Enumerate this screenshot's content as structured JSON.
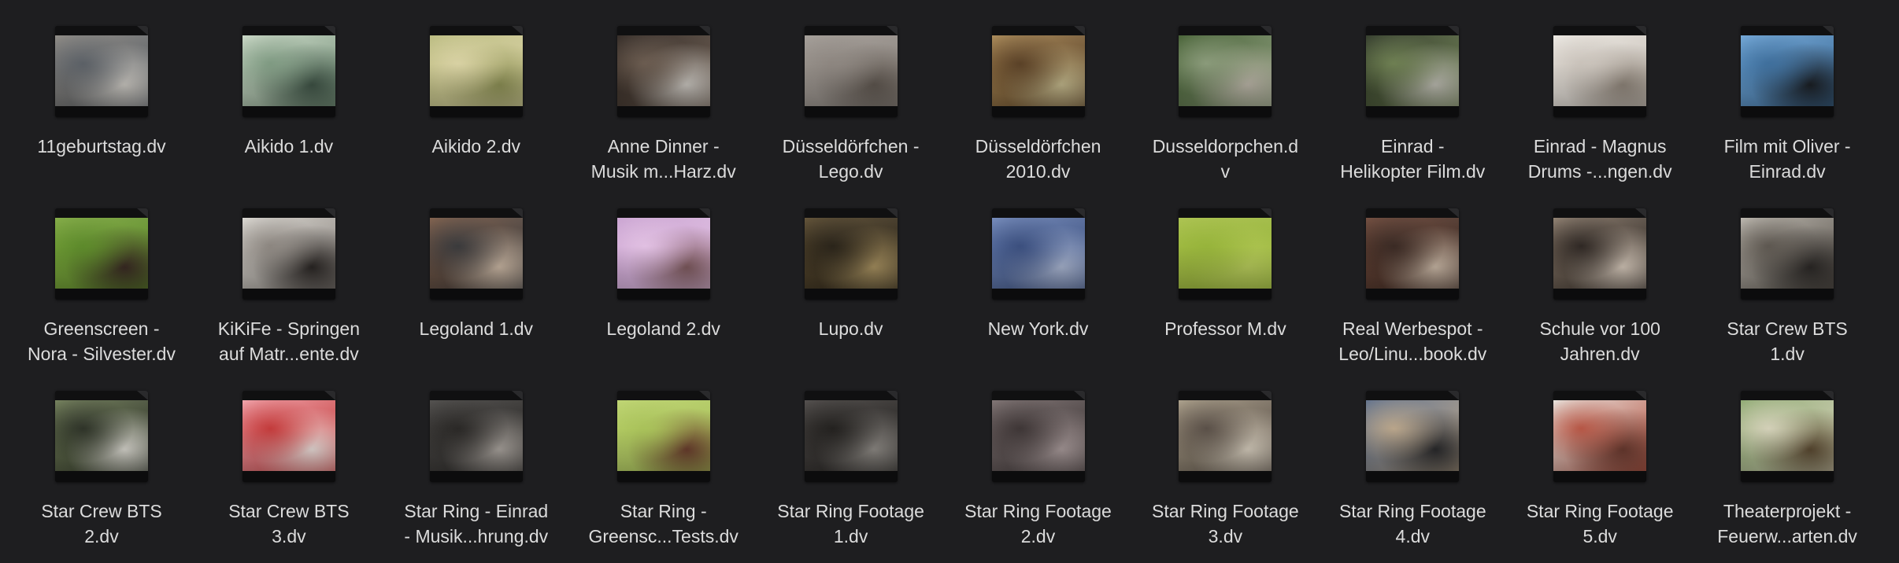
{
  "files": [
    {
      "lines": [
        "11geburtstag.dv"
      ],
      "colors": [
        "#8a8680",
        "#5b6066",
        "#c9c6c0"
      ]
    },
    {
      "lines": [
        "Aikido 1.dv"
      ],
      "colors": [
        "#c8d6c4",
        "#7f9a82",
        "#3e5245"
      ]
    },
    {
      "lines": [
        "Aikido 2.dv"
      ],
      "colors": [
        "#b7b87a",
        "#d8d1a3",
        "#8c8f55"
      ]
    },
    {
      "lines": [
        "Anne Dinner -",
        "Musik m...Harz.dv"
      ],
      "colors": [
        "#2a211c",
        "#6b5c50",
        "#c7c3bd"
      ]
    },
    {
      "lines": [
        "Düsseldörfchen -",
        "Lego.dv"
      ],
      "colors": [
        "#a09a94",
        "#8d8680",
        "#5e564f"
      ]
    },
    {
      "lines": [
        "Düsseldörfchen",
        "2010.dv"
      ],
      "colors": [
        "#a78652",
        "#5a4127",
        "#c0b58a"
      ]
    },
    {
      "lines": [
        "Dusseldorpchen.d",
        "v"
      ],
      "colors": [
        "#3e5a2c",
        "#8a9a7a",
        "#b9b3a6"
      ]
    },
    {
      "lines": [
        "Einrad -",
        "Helikopter Film.dv"
      ],
      "colors": [
        "#2a3322",
        "#6e7f52",
        "#b9b8ae"
      ]
    },
    {
      "lines": [
        "Einrad - Magnus",
        "Drums -...ngen.dv"
      ],
      "colors": [
        "#ece8e2",
        "#c9c2ba",
        "#8f857a"
      ]
    },
    {
      "lines": [
        "Film mit Oliver -",
        "Einrad.dv"
      ],
      "colors": [
        "#6da4d6",
        "#3f6f9c",
        "#1b1f24"
      ]
    },
    {
      "lines": [
        "Greenscreen -",
        "Nora - Silvester.dv"
      ],
      "colors": [
        "#7ea83e",
        "#5d8a2b",
        "#3a2a24"
      ]
    },
    {
      "lines": [
        "KiKiFe - Springen",
        "auf Matr...ente.dv"
      ],
      "colors": [
        "#d9d6d0",
        "#8c8680",
        "#2a2624"
      ]
    },
    {
      "lines": [
        "Legoland 1.dv"
      ],
      "colors": [
        "#7b5a45",
        "#3a3a3c",
        "#c8b5a2"
      ]
    },
    {
      "lines": [
        "Legoland 2.dv"
      ],
      "colors": [
        "#c79fcf",
        "#e1c0e2",
        "#7e5a5e"
      ]
    },
    {
      "lines": [
        "Lupo.dv"
      ],
      "colors": [
        "#5a4a2e",
        "#2a241a",
        "#a58f5f"
      ]
    },
    {
      "lines": [
        "New York.dv"
      ],
      "colors": [
        "#6f86b8",
        "#3b4f7e",
        "#a8b4cf"
      ]
    },
    {
      "lines": [
        "Professor M.dv"
      ],
      "colors": [
        "#a8c048",
        "#97b43b",
        "#b7cb5b"
      ]
    },
    {
      "lines": [
        "Real Werbespot -",
        "Leo/Linu...book.dv"
      ],
      "colors": [
        "#6b4536",
        "#3a2a24",
        "#c9b7a5"
      ]
    },
    {
      "lines": [
        "Schule vor 100",
        "Jahren.dv"
      ],
      "colors": [
        "#8b7b6b",
        "#2f2824",
        "#d3c6b8"
      ]
    },
    {
      "lines": [
        "Star Crew BTS",
        "1.dv"
      ],
      "colors": [
        "#b9b4ab",
        "#5d5750",
        "#2b2826"
      ]
    },
    {
      "lines": [
        "Star Crew BTS",
        "2.dv"
      ],
      "colors": [
        "#6e7b55",
        "#2e3328",
        "#d9d7cf"
      ]
    },
    {
      "lines": [
        "Star Crew BTS",
        "3.dv"
      ],
      "colors": [
        "#f0a0a8",
        "#c33b3b",
        "#e9dcd8"
      ]
    },
    {
      "lines": [
        "Star Ring - Einrad",
        "- Musik...hrung.dv"
      ],
      "colors": [
        "#4a4846",
        "#2a2826",
        "#a9a39d"
      ]
    },
    {
      "lines": [
        "Star Ring -",
        "Greensc...Tests.dv"
      ],
      "colors": [
        "#bcd36c",
        "#a9c25a",
        "#6b3e2e"
      ]
    },
    {
      "lines": [
        "Star Ring Footage",
        "1.dv"
      ],
      "colors": [
        "#4a4644",
        "#23211f",
        "#8e8a85"
      ]
    },
    {
      "lines": [
        "Star Ring Footage",
        "2.dv"
      ],
      "colors": [
        "#7a6e6e",
        "#3e3636",
        "#a89a9a"
      ]
    },
    {
      "lines": [
        "Star Ring Footage",
        "3.dv"
      ],
      "colors": [
        "#a89c86",
        "#5a5048",
        "#d6cdbd"
      ]
    },
    {
      "lines": [
        "Star Ring Footage",
        "4.dv"
      ],
      "colors": [
        "#5a6b86",
        "#b9a58a",
        "#2a2a2c"
      ]
    },
    {
      "lines": [
        "Star Ring Footage",
        "5.dv"
      ],
      "colors": [
        "#e7e3dd",
        "#b65645",
        "#6a3a2f"
      ]
    },
    {
      "lines": [
        "Theaterprojekt -",
        "Feuerw...arten.dv"
      ],
      "colors": [
        "#8aa66c",
        "#d3d0b8",
        "#5b4a32"
      ]
    }
  ]
}
